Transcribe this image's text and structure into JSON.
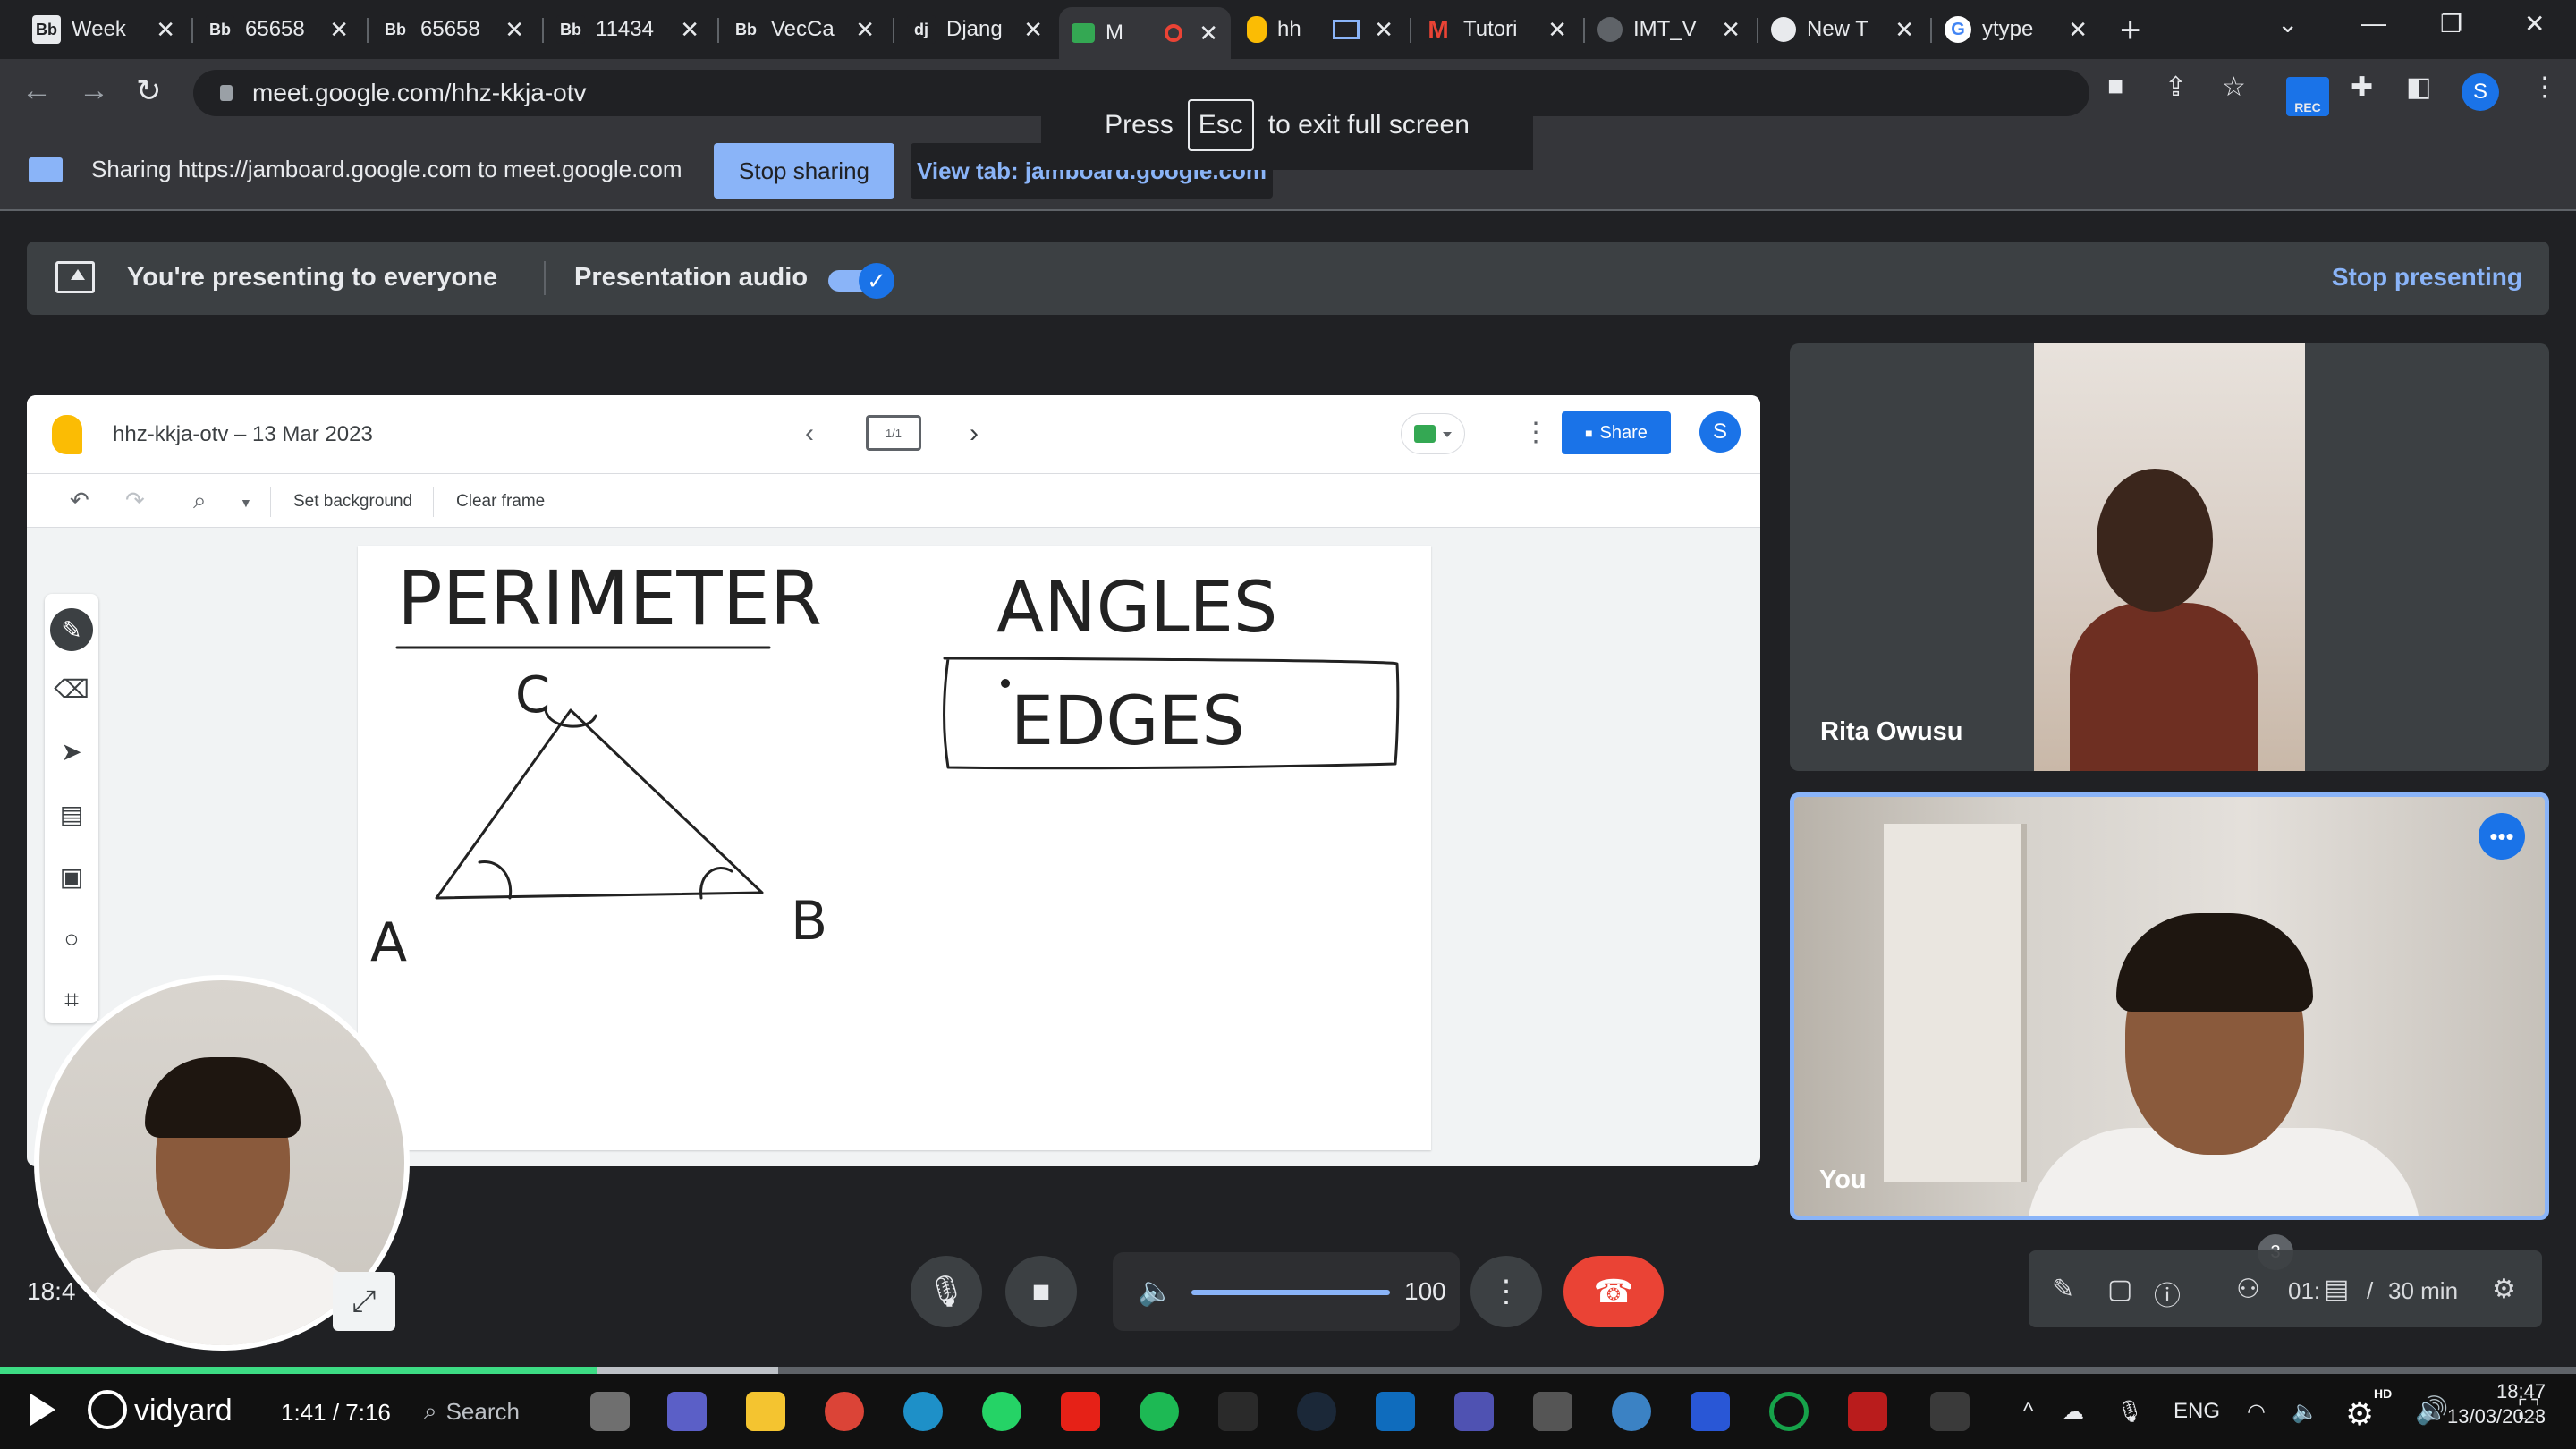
{
  "browser": {
    "tabs": [
      {
        "favicon": "Bb",
        "title": "Week"
      },
      {
        "favicon": "Bb",
        "title": "65658"
      },
      {
        "favicon": "Bb",
        "title": "65658"
      },
      {
        "favicon": "Bb",
        "title": "11434"
      },
      {
        "favicon": "Bb",
        "title": "VecCa"
      },
      {
        "favicon": "dj",
        "title": "Djang"
      },
      {
        "favicon": "meet-icon",
        "title": "M"
      },
      {
        "favicon": "jamboard-icon",
        "title": "hh"
      },
      {
        "favicon": "gmail-icon",
        "title": "Tutori"
      },
      {
        "favicon": "globe-icon",
        "title": "IMT_V"
      },
      {
        "favicon": "chrome-icon",
        "title": "New T"
      },
      {
        "favicon": "google-icon",
        "title": "ytype"
      }
    ],
    "active_tab_index": 6,
    "url": "meet.google.com/hhz-kkja-otv",
    "profile_initial": "S",
    "rec_badge": "REC"
  },
  "fullscreen_toast": {
    "prefix": "Press",
    "key": "Esc",
    "suffix": "to exit full screen"
  },
  "sharing_bar": {
    "message": "Sharing https://jamboard.google.com to meet.google.com",
    "stop_label": "Stop sharing",
    "view_tab_label": "View tab: jamboard.google.com"
  },
  "presenting_banner": {
    "text": "You're presenting to everyone",
    "audio_label": "Presentation audio",
    "audio_on": true,
    "stop_label": "Stop presenting"
  },
  "jamboard": {
    "title": "hhz-kkja-otv – 13 Mar 2023",
    "frame_indicator": "1/1",
    "share_label": "Share",
    "avatar_initial": "S",
    "toolbar": {
      "set_background": "Set background",
      "clear_frame": "Clear frame"
    },
    "canvas_text": {
      "perimeter": "PERIMETER",
      "angles": "ANGLES",
      "edges": "EDGES",
      "vertex_a": "A",
      "vertex_b": "B",
      "vertex_c": "C"
    }
  },
  "participants": [
    {
      "name": "Rita Owusu"
    },
    {
      "name": "You"
    }
  ],
  "controls": {
    "volume": "100",
    "volume_level": 1.0
  },
  "mini_toolbar": {
    "badge": "3",
    "timer": "01:",
    "slash": "/",
    "minutes": "30 min"
  },
  "left_clock": "18:4",
  "player": {
    "brand": "vidyard",
    "timecode": "1:41 / 7:16",
    "progress_fraction": 0.232,
    "buffer_fraction": 0.302,
    "hd_label": "HD"
  },
  "taskbar": {
    "search_label": "Search",
    "language": "ENG",
    "time": "18:47",
    "date": "13/03/2023"
  }
}
